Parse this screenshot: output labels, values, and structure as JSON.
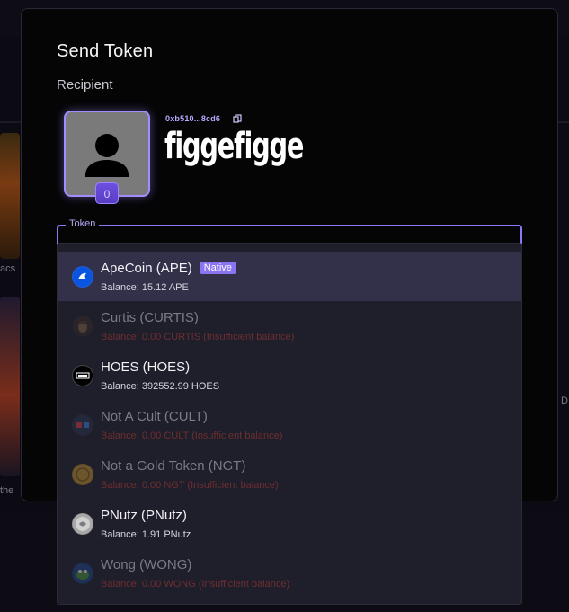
{
  "dialog": {
    "title": "Send Token",
    "recipient_label": "Recipient",
    "avatar_badge": "0",
    "recipient_address": "0xb510...8cd6",
    "recipient_handle": "figgefigge",
    "token_field_label": "Token"
  },
  "background": {
    "left_text": "acs",
    "bottom_left_text": "the",
    "right_text": "D"
  },
  "tokens": [
    {
      "name": "ApeCoin (APE)",
      "badge": "Native",
      "balance": "Balance: 15.12 APE",
      "state": "selected",
      "icon": "apecoin-icon"
    },
    {
      "name": "Curtis (CURTIS)",
      "balance": "Balance: 0.00 CURTIS (Insufficient balance)",
      "state": "disabled",
      "icon": "curtis-icon"
    },
    {
      "name": "HOES (HOES)",
      "balance": "Balance: 392552.99 HOES",
      "state": "enabled",
      "icon": "hoes-icon"
    },
    {
      "name": "Not A Cult (CULT)",
      "balance": "Balance: 0.00 CULT (Insufficient balance)",
      "state": "disabled",
      "icon": "cult-icon"
    },
    {
      "name": "Not a Gold Token (NGT)",
      "balance": "Balance: 0.00 NGT (Insufficient balance)",
      "state": "disabled",
      "icon": "ngt-icon"
    },
    {
      "name": "PNutz (PNutz)",
      "balance": "Balance: 1.91 PNutz",
      "state": "enabled",
      "icon": "pnutz-icon"
    },
    {
      "name": "Wong (WONG)",
      "balance": "Balance: 0.00 WONG (Insufficient balance)",
      "state": "disabled",
      "icon": "wong-icon"
    }
  ],
  "colors": {
    "accent": "#8f78f5",
    "insufficient": "#6d2f2f",
    "dropdown_bg": "#1f1e2b",
    "selected_bg": "#333049"
  }
}
